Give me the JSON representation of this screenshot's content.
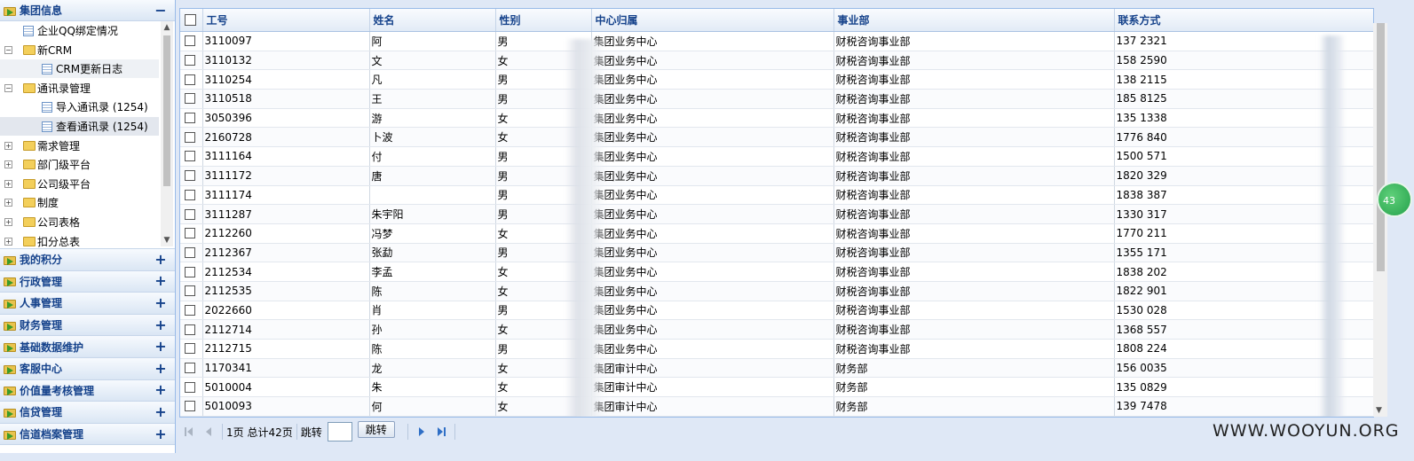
{
  "sidebar": {
    "top_header": "集团信息",
    "tree": [
      {
        "label": "企业QQ绑定情况",
        "type": "page",
        "level": 1
      },
      {
        "label": "新CRM",
        "type": "folder",
        "level": 0,
        "expanded": true
      },
      {
        "label": "CRM更新日志",
        "type": "page",
        "level": 2
      },
      {
        "label": "通讯录管理",
        "type": "folder",
        "level": 0,
        "expanded": true
      },
      {
        "label": "导入通讯录 (1254)",
        "type": "page",
        "level": 2
      },
      {
        "label": "查看通讯录 (1254)",
        "type": "page",
        "level": 2
      },
      {
        "label": "需求管理",
        "type": "folder",
        "level": 0
      },
      {
        "label": "部门级平台",
        "type": "folder",
        "level": 0
      },
      {
        "label": "公司级平台",
        "type": "folder",
        "level": 0
      },
      {
        "label": "制度",
        "type": "folder",
        "level": 0
      },
      {
        "label": "公司表格",
        "type": "folder",
        "level": 0
      },
      {
        "label": "扣分总表",
        "type": "folder",
        "level": 0
      }
    ],
    "sections": [
      "我的积分",
      "行政管理",
      "人事管理",
      "财务管理",
      "基础数据维护",
      "客服中心",
      "价值量考核管理",
      "信贷管理",
      "信道档案管理"
    ],
    "expand_symbol": "+",
    "collapse_symbol": "−"
  },
  "grid": {
    "columns": [
      "工号",
      "姓名",
      "性别",
      "中心归属",
      "事业部",
      "联系方式"
    ],
    "rows": [
      [
        "3110097",
        "阿",
        "男",
        "集团业务中心",
        "财税咨询事业部",
        "137 2321"
      ],
      [
        "3110132",
        "文",
        "女",
        "集团业务中心",
        "财税咨询事业部",
        "158 2590"
      ],
      [
        "3110254",
        "凡",
        "男",
        "集团业务中心",
        "财税咨询事业部",
        "138 2115"
      ],
      [
        "3110518",
        "王",
        "男",
        "集团业务中心",
        "财税咨询事业部",
        "185 8125"
      ],
      [
        "3050396",
        "游",
        "女",
        "集团业务中心",
        "财税咨询事业部",
        "135 1338"
      ],
      [
        "2160728",
        "卜波",
        "女",
        "集团业务中心",
        "财税咨询事业部",
        "1776 840"
      ],
      [
        "3111164",
        "付",
        "男",
        "集团业务中心",
        "财税咨询事业部",
        "1500 571"
      ],
      [
        "3111172",
        "唐",
        "男",
        "集团业务中心",
        "财税咨询事业部",
        "1820 329"
      ],
      [
        "3111174",
        "",
        "男",
        "集团业务中心",
        "财税咨询事业部",
        "1838 387"
      ],
      [
        "3111287",
        "朱宇阳",
        "男",
        "集团业务中心",
        "财税咨询事业部",
        "1330 317"
      ],
      [
        "2112260",
        "冯梦",
        "女",
        "集团业务中心",
        "财税咨询事业部",
        "1770 211"
      ],
      [
        "2112367",
        "张勐",
        "男",
        "集团业务中心",
        "财税咨询事业部",
        "1355 171"
      ],
      [
        "2112534",
        "李孟",
        "女",
        "集团业务中心",
        "财税咨询事业部",
        "1838 202"
      ],
      [
        "2112535",
        "陈",
        "女",
        "集团业务中心",
        "财税咨询事业部",
        "1822 901"
      ],
      [
        "2022660",
        "肖",
        "男",
        "集团业务中心",
        "财税咨询事业部",
        "1530 028"
      ],
      [
        "2112714",
        "孙",
        "女",
        "集团业务中心",
        "财税咨询事业部",
        "1368 557"
      ],
      [
        "2112715",
        "陈",
        "男",
        "集团业务中心",
        "财税咨询事业部",
        "1808 224"
      ],
      [
        "1170341",
        "龙",
        "女",
        "集团审计中心",
        "财务部",
        "156 0035"
      ],
      [
        "5010004",
        "朱",
        "女",
        "集团审计中心",
        "财务部",
        "135 0829"
      ],
      [
        "5010093",
        "何",
        "女",
        "集团审计中心",
        "财务部",
        "139 7478"
      ]
    ]
  },
  "pager": {
    "page_text": "1页 总计42页",
    "jump_label": "跳转",
    "jump_button": "跳转",
    "jump_value": ""
  },
  "watermark": "WWW.WOOYUN.ORG",
  "side_badge": "43"
}
